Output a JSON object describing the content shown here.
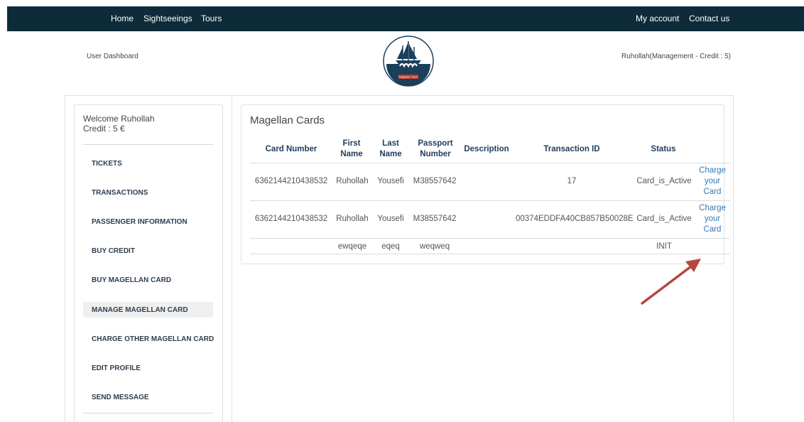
{
  "nav": {
    "home": "Home",
    "sightseeings": "Sightseeings",
    "tours": "Tours",
    "my_account": "My account",
    "contact_us": "Contact us"
  },
  "header": {
    "dashboard_label": "User Dashboard",
    "user_info": "Ruhollah(Management - Credit : 5)",
    "logo_text": "Magellan Tours"
  },
  "sidebar": {
    "welcome": "Welcome Ruhollah",
    "credit": "Credit : 5 €",
    "items": [
      {
        "label": "TICKETS"
      },
      {
        "label": "TRANSACTIONS"
      },
      {
        "label": "PASSENGER INFORMATION"
      },
      {
        "label": "BUY CREDIT"
      },
      {
        "label": "BUY MAGELLAN CARD"
      },
      {
        "label": "MANAGE MAGELLAN CARD"
      },
      {
        "label": "CHARGE OTHER MAGELLAN CARD"
      },
      {
        "label": "EDIT PROFILE"
      },
      {
        "label": "SEND MESSAGE"
      }
    ]
  },
  "cards": {
    "title": "Magellan Cards",
    "headers": {
      "card_number": "Card Number",
      "first_name_1": "First",
      "first_name_2": "Name",
      "last_name_1": "Last",
      "last_name_2": "Name",
      "passport_1": "Passport",
      "passport_2": "Number",
      "description": "Description",
      "transaction_id": "Transaction ID",
      "status": "Status"
    },
    "rows": [
      {
        "card_number": "6362144210438532",
        "first_name": "Ruhollah",
        "last_name": "Yousefi",
        "passport": "M38557642",
        "description": "",
        "transaction_id": "17",
        "status": "Card_is_Active",
        "action_1": "Charge",
        "action_2": "your",
        "action_3": "Card"
      },
      {
        "card_number": "6362144210438532",
        "first_name": "Ruhollah",
        "last_name": "Yousefi",
        "passport": "M38557642",
        "description": "",
        "transaction_id": "00374EDDFA40CB857B50028E",
        "status": "Card_is_Active",
        "action_1": "Charge",
        "action_2": "your",
        "action_3": "Card"
      },
      {
        "card_number": "",
        "first_name": "ewqeqe",
        "last_name": "eqeq",
        "passport": "weqweq",
        "description": "",
        "transaction_id": "",
        "status": "INIT"
      }
    ]
  },
  "colors": {
    "nav_bg": "#0d2b39",
    "link": "#337ab7",
    "header_text": "#1f3d5a",
    "arrow": "#b5473f"
  }
}
